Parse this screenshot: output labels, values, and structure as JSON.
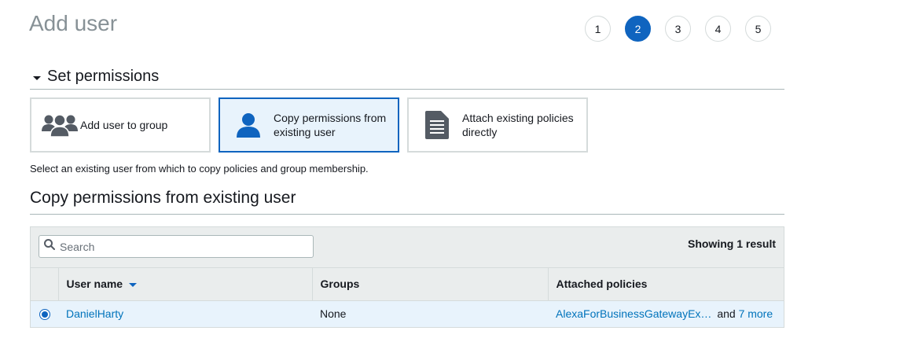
{
  "page_title": "Add user",
  "steps": [
    "1",
    "2",
    "3",
    "4",
    "5"
  ],
  "active_step": "2",
  "section": {
    "title": "Set permissions"
  },
  "options": [
    {
      "label": "Add user to group",
      "icon": "group-icon",
      "selected": false
    },
    {
      "label": "Copy permissions from existing user",
      "icon": "user-icon",
      "selected": true
    },
    {
      "label": "Attach existing policies directly",
      "icon": "document-icon",
      "selected": false
    }
  ],
  "helper_text": "Select an existing user from which to copy policies and group membership.",
  "sub_section": {
    "title": "Copy permissions from existing user"
  },
  "search": {
    "placeholder": "Search",
    "value": ""
  },
  "showing_text": "Showing 1 result",
  "table": {
    "columns": [
      "User name",
      "Groups",
      "Attached policies"
    ],
    "rows": [
      {
        "user_name": "DanielHarty",
        "groups": "None",
        "policy_link": "AlexaForBusinessGatewayEx…",
        "and_text": "and",
        "more_link": "7 more",
        "selected": true
      }
    ]
  },
  "colors": {
    "accent": "#0f64bf",
    "link": "#0073bb",
    "selected_bg": "#e8f3fc",
    "header_bg": "#eaeded",
    "icon_gray": "#545b64"
  }
}
